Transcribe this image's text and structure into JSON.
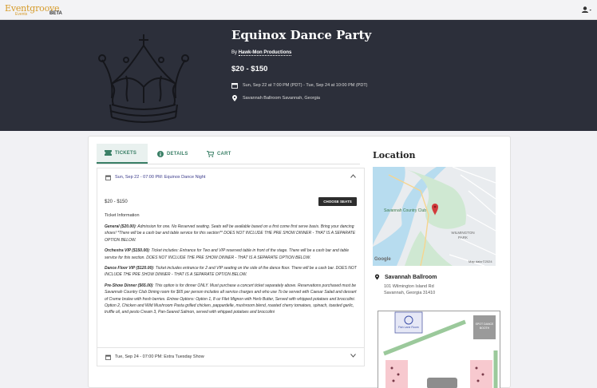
{
  "brand": {
    "name": "Eventgroove",
    "sub": "Events",
    "beta": "BETA"
  },
  "hero": {
    "title": "Equinox Dance Party",
    "org_prefix": "By",
    "org": "Hawk-Mon Productions",
    "price": "$20 - $150",
    "dates": "Sun, Sep 22 at 7:00 PM (PDT) - Tue, Sep 24 at 10:00 PM (PDT)",
    "venue": "Savannah Ballroom Savannah, Georgia"
  },
  "tabs": [
    {
      "label": "TICKETS",
      "icon": "ticket-icon"
    },
    {
      "label": "DETAILS",
      "icon": "info-icon"
    },
    {
      "label": "CART",
      "icon": "cart-icon"
    }
  ],
  "accordion": {
    "first": {
      "label": "Sun, Sep 22 - 07:00 PM: Equinox Dance Night"
    },
    "second": {
      "label": "Tue, Sep 24 - 07:00 PM: Extra Tuesday Show"
    }
  },
  "ticket": {
    "price_range": "$20 - $150",
    "choose_button": "CHOOSE SEATS",
    "info_title": "Ticket Information",
    "items": [
      {
        "name": "General ($20.00)",
        "text": ": Admission for one. No Reserved seating. Seats will be available based on a first come first serve basis. Bring your dancing shoes! *There will be a cash bar and table service for this section** DOES NOT INCLUDE THE PRE SHOW DINNER - THAT IS A SEPARATE OPTION BELOW."
      },
      {
        "name": "Orchestra VIP ($150.00)",
        "text": ": Ticket includes: Entrance for Two and VIP reserved table in front of the stage. There will be a cash bar and table service for this section. DOES NOT INCLUDE THE PRE SHOW DINNER - THAT IS A SEPARATE OPTION BELOW."
      },
      {
        "name": "Dance Floor VIP ($120.00)",
        "text": ": Ticket includes entrance for 2 and VIP seating on the side of the dance floor. There will be a cash bar. DOES NOT INCLUDE THE PRE SHOW DINNER - THAT IS A SEPARATE OPTION BELOW."
      },
      {
        "name": "Pre-Show Dinner ($65.00)",
        "text": ": This option is for dinner ONLY. Must purchase a concert ticket separately above. Reservations purchased must be Savannah Country Club Dining room for $65 per person includes all service charges and who use To be served with Caesar Salad and dessert of Creme brulee with fresh berries. Entree Options: Option 1, 8 oz Filet Mignon with Herb Butter, Served with whipped potatoes and broccolini. Option 2, Chicken and Wild Mushroom Pasta grilled chicken, pappardelle, mushroom blend, roasted cherry tomatoes, spinach, toasted garlic, truffle oil, and pesto Cream 3, Pan-Seared Salmon, served with whipped potatoes and broccolini"
      }
    ]
  },
  "location": {
    "title": "Location",
    "venue": "Savannah Ballroom",
    "address1": "101 Wilmington Island Rd",
    "address2": "Savannah, Georgia 31410",
    "map": {
      "country_club": "Savannah Country Club",
      "park": "WILMINGTON PARK",
      "google": "Google",
      "map_credit": "Map data ©2024"
    },
    "floor": {
      "stage_label": "Fish Lane Room",
      "booth_label": "SPOT DANCE BOOTH"
    }
  }
}
